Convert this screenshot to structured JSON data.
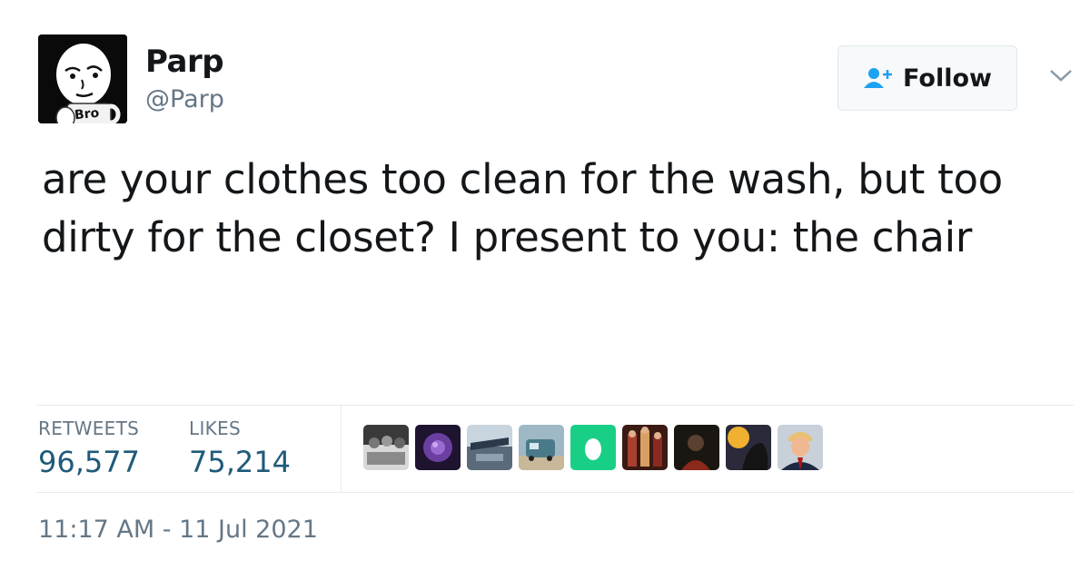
{
  "author": {
    "display_name": "Parp",
    "handle": "@Parp",
    "avatar_mug_text": "Bro"
  },
  "follow_button": {
    "label": "Follow"
  },
  "tweet": {
    "text": "are your clothes too clean for the wash, but too dirty for the closet? I present to you: the chair"
  },
  "stats": {
    "retweets_label": "RETWEETS",
    "retweets_value": "96,577",
    "likes_label": "LIKES",
    "likes_value": "75,214"
  },
  "likers": [
    {
      "icon": "liker-photo-group",
      "color": "#5a5a5a"
    },
    {
      "icon": "liker-purple-flower",
      "color": "#4b2a6a"
    },
    {
      "icon": "liker-car-dashboard",
      "color": "#6e8294"
    },
    {
      "icon": "liker-van",
      "color": "#7a9aaa"
    },
    {
      "icon": "liker-default-egg",
      "color": "#19cf86"
    },
    {
      "icon": "liker-crowd",
      "color": "#8a3a2a"
    },
    {
      "icon": "liker-dark-portrait",
      "color": "#2a2622"
    },
    {
      "icon": "liker-sunset-figure",
      "color": "#d89a2a"
    },
    {
      "icon": "liker-man-suit",
      "color": "#b0b8c4"
    }
  ],
  "timestamp": "11:17 AM - 11 Jul 2021",
  "colors": {
    "text": "#14171a",
    "muted": "#657786",
    "stat_value": "#1f5a7a",
    "follow_icon": "#1da1f2"
  }
}
